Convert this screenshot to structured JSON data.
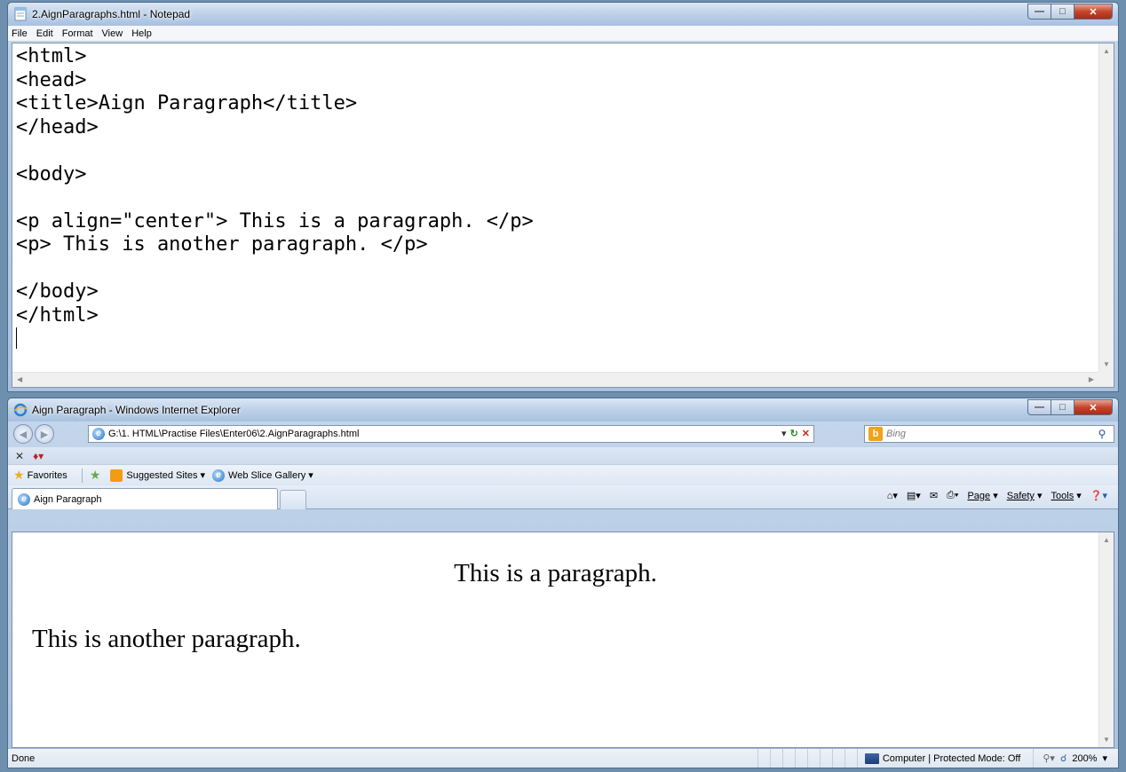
{
  "notepad": {
    "title": "2.AignParagraphs.html - Notepad",
    "menu": [
      "File",
      "Edit",
      "Format",
      "View",
      "Help"
    ],
    "content_lines": [
      "<html>",
      "<head>",
      "<title>Aign Paragraph</title>",
      "</head>",
      "",
      "<body>",
      "",
      "<p align=\"center\"> This is a paragraph. </p>",
      "<p> This is another paragraph. </p>",
      "",
      "</body>",
      "</html>"
    ]
  },
  "ie": {
    "title": "Aign Paragraph - Windows Internet Explorer",
    "address": "G:\\1. HTML\\Practise Files\\Enter06\\2.AignParagraphs.html",
    "search_placeholder": "Bing",
    "favorites_label": "Favorites",
    "suggested_sites": "Suggested Sites",
    "web_slice_gallery": "Web Slice Gallery",
    "tab_title": "Aign Paragraph",
    "tools": {
      "page": "Page",
      "safety": "Safety",
      "tools": "Tools"
    },
    "page": {
      "paragraph_center": "This is a paragraph.",
      "paragraph_left": "This is another paragraph."
    },
    "status": {
      "left": "Done",
      "zone": "Computer | Protected Mode: Off",
      "zoom": "200%"
    }
  },
  "icons": [
    "notepad-icon",
    "ie-icon",
    "back-icon",
    "forward-icon",
    "refresh-icon",
    "stop-icon",
    "search-icon",
    "star-icon",
    "home-icon",
    "feeds-icon",
    "mail-icon",
    "print-icon",
    "help-icon",
    "network-icon",
    "zoom-icon"
  ]
}
